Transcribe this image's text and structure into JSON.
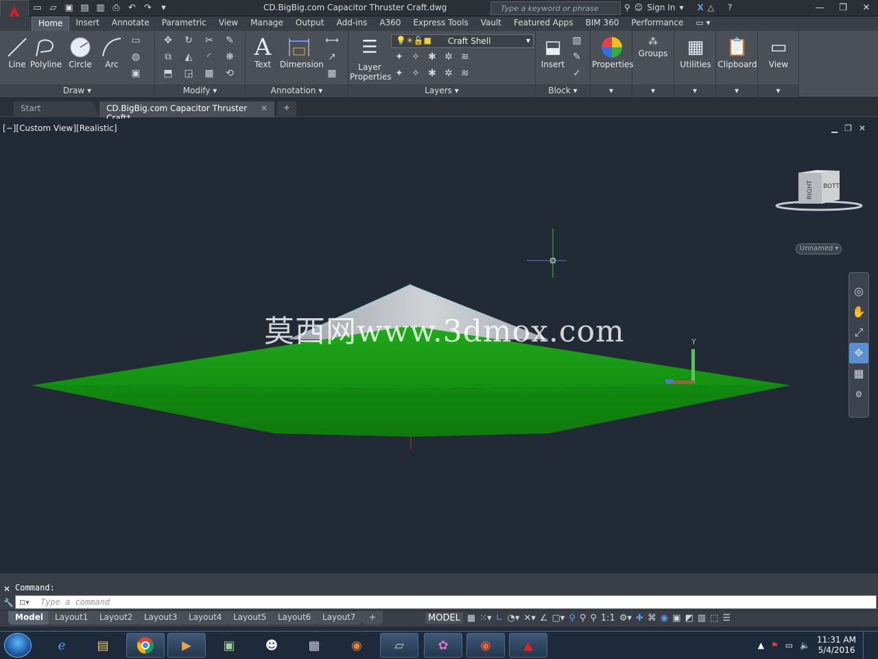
{
  "titlebar": {
    "title": "CD.BigBig.com Capacitor Thruster Craft.dwg",
    "search_placeholder": "Type a keyword or phrase",
    "signin": "Sign In"
  },
  "ribbon_tabs": [
    "Home",
    "Insert",
    "Annotate",
    "Parametric",
    "View",
    "Manage",
    "Output",
    "Add-ins",
    "A360",
    "Express Tools",
    "Vault",
    "Featured Apps",
    "BIM 360",
    "Performance"
  ],
  "ribbon": {
    "draw": {
      "title": "Draw",
      "line": "Line",
      "polyline": "Polyline",
      "circle": "Circle",
      "arc": "Arc"
    },
    "modify": {
      "title": "Modify"
    },
    "annotation": {
      "title": "Annotation",
      "text": "Text",
      "dimension": "Dimension"
    },
    "layers": {
      "title": "Layers",
      "layer_properties": "Layer Properties",
      "current_layer": "Craft Shell"
    },
    "block": {
      "title": "Block",
      "insert": "Insert"
    },
    "properties": "Properties",
    "groups": "Groups",
    "utilities": "Utilities",
    "clipboard": "Clipboard",
    "view": "View"
  },
  "file_tabs": {
    "start": "Start",
    "drawing": "CD.BigBig.com Capacitor Thruster Craft*"
  },
  "viewport": {
    "label": "[−][Custom View][Realistic]",
    "watermark": "莫西网www.3dmox.com",
    "viewcube_right": "RIGHT",
    "viewcube_bottom": "BOTTOM",
    "ucs_name": "Unnamed",
    "ucs_y": "Y",
    "colors": {
      "background": "#222a35",
      "shell_green": "#1a9a14",
      "dome": "#b8bcc0"
    }
  },
  "command": {
    "history": "Command:",
    "placeholder": "Type a command"
  },
  "layouts": [
    "Model",
    "Layout1",
    "Layout2",
    "Layout3",
    "Layout4",
    "Layout5",
    "Layout6",
    "Layout7"
  ],
  "status": {
    "model": "MODEL",
    "scale": "1:1"
  },
  "taskbar": {
    "time": "11:31 AM",
    "date": "5/4/2016"
  }
}
